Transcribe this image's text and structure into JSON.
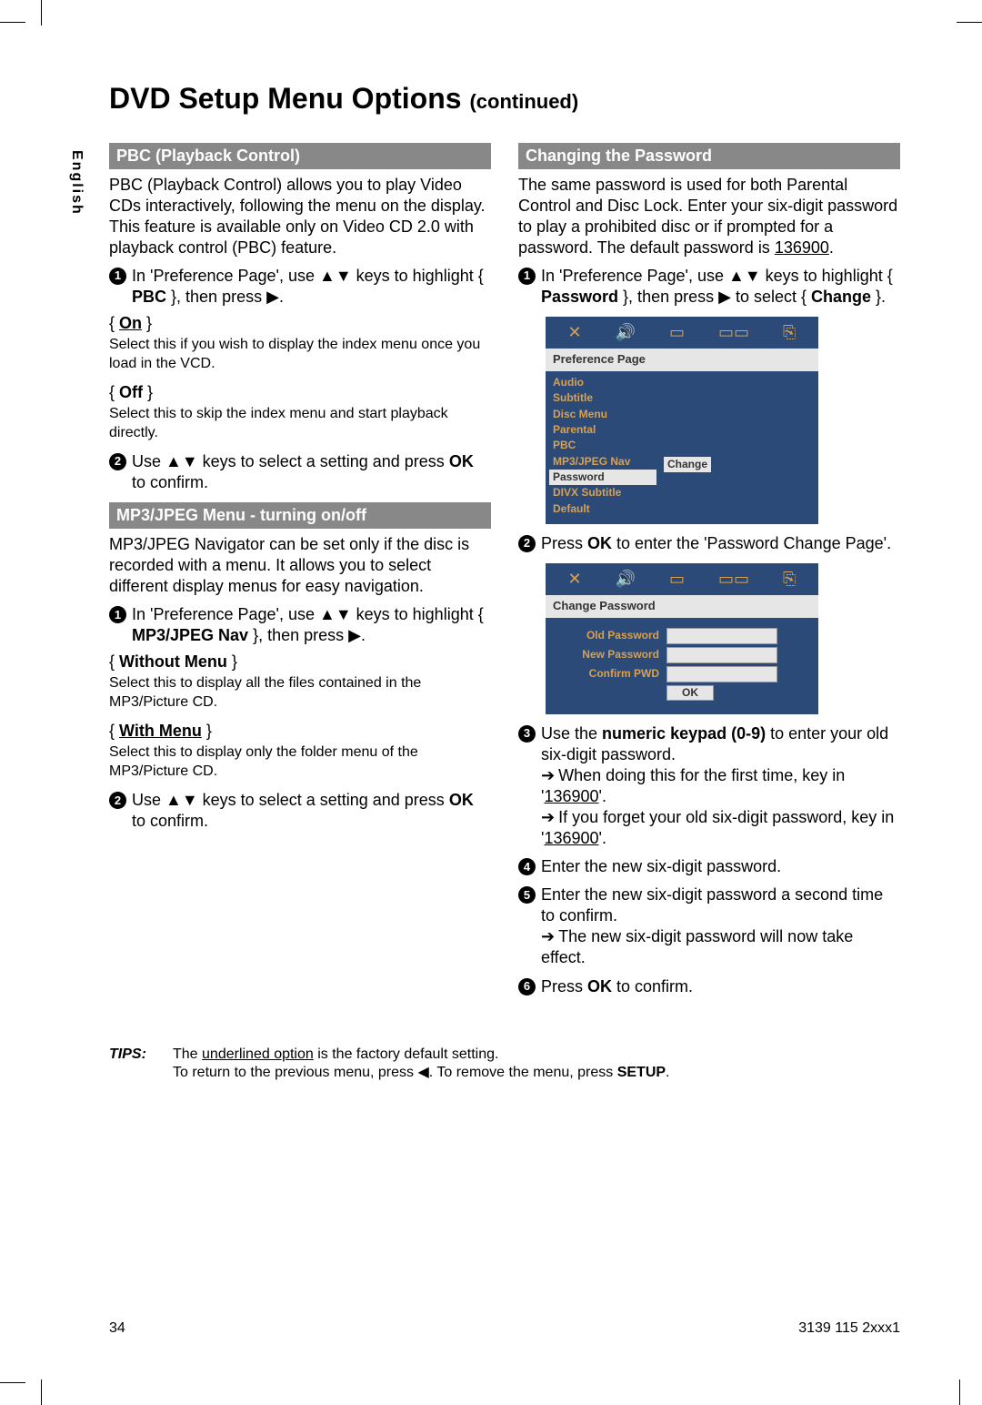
{
  "side_tab": "English",
  "title_main": "DVD Setup Menu Options ",
  "title_cont": "(continued)",
  "left": {
    "sec1_header": "PBC (Playback Control)",
    "sec1_intro": "PBC (Playback Control) allows you to play Video CDs interactively, following the menu on the display.  This feature is available only on Video CD 2.0 with playback control (PBC) feature.",
    "sec1_step1_a": "In 'Preference Page', use ",
    "sec1_step1_b": " keys to highlight { ",
    "sec1_step1_pbc": "PBC",
    "sec1_step1_c": " }, then press ",
    "sec1_step1_d": ".",
    "opt_on": "On",
    "opt_on_desc": "Select this if you wish to display the index menu once you load in the VCD.",
    "opt_off": "Off",
    "opt_off_desc": "Select this to skip the index menu and start playback directly.",
    "sec1_step2_a": "Use ",
    "sec1_step2_b": " keys to select a setting and press ",
    "sec1_step2_ok": "OK",
    "sec1_step2_c": " to confirm.",
    "sec2_header": "MP3/JPEG Menu - turning on/off",
    "sec2_intro": "MP3/JPEG Navigator can be set only if the disc is recorded with a menu.  It allows you to select different display menus for easy navigation.",
    "sec2_step1_a": "In 'Preference Page', use ",
    "sec2_step1_b": " keys to highlight { ",
    "sec2_step1_nav": "MP3/JPEG Nav",
    "sec2_step1_c": " }, then press ",
    "sec2_step1_d": ".",
    "opt_wo": "Without Menu",
    "opt_wo_desc": "Select this to display all the files contained in the MP3/Picture CD.",
    "opt_with": "With Menu",
    "opt_with_desc": "Select this to display only the folder menu of the MP3/Picture CD.",
    "sec2_step2_a": "Use ",
    "sec2_step2_b": " keys to select a setting and press ",
    "sec2_step2_ok": "OK",
    "sec2_step2_c": " to confirm."
  },
  "right": {
    "sec1_header": "Changing the Password",
    "sec1_intro_a": "The same password is used for both Parental Control and Disc Lock.  Enter your six-digit password to play a prohibited disc or if prompted for a password.  The default password is ",
    "default_pwd": "136900",
    "sec1_intro_b": ".",
    "step1_a": "In 'Preference Page', use ",
    "step1_b": " keys to highlight { ",
    "step1_pwd": "Password",
    "step1_c": " }, then press ",
    "step1_d": " to select { ",
    "step1_change": "Change",
    "step1_e": " }.",
    "ui1": {
      "title": "Preference Page",
      "items": [
        "Audio",
        "Subtitle",
        "Disc Menu",
        "Parental",
        "PBC",
        "MP3/JPEG Nav",
        "Password",
        "DIVX Subtitle",
        "Default"
      ],
      "right_label": "Change"
    },
    "step2_a": "Press ",
    "step2_ok": "OK",
    "step2_b": " to enter the 'Password Change Page'.",
    "ui2": {
      "title": "Change Password",
      "rows": [
        "Old Password",
        "New Password",
        "Confirm PWD"
      ],
      "ok": "OK"
    },
    "step3_a": "Use the ",
    "step3_keypad": "numeric keypad (0-9)",
    "step3_b": " to enter your old six-digit password.",
    "step3_r1_a": "When doing this for the first time, key in '",
    "step3_r1_pwd": "136900",
    "step3_r1_b": "'.",
    "step3_r2_a": "If you forget your old six-digit password, key in '",
    "step3_r2_pwd": "136900",
    "step3_r2_b": "'.",
    "step4": "Enter the new six-digit password.",
    "step5_a": "Enter the new six-digit password a second time to confirm.",
    "step5_r": "The new six-digit password will now take effect.",
    "step6_a": "Press ",
    "step6_ok": "OK",
    "step6_b": " to confirm."
  },
  "tips": {
    "label": "TIPS:",
    "line1_a": "The ",
    "line1_u": "underlined option",
    "line1_b": " is the factory default setting.",
    "line2_a": "To return to the previous menu, press ",
    "line2_b": ".  To remove the menu, press ",
    "line2_setup": "SETUP",
    "line2_c": "."
  },
  "footer": {
    "page": "34",
    "code": "3139 115 2xxx1"
  }
}
